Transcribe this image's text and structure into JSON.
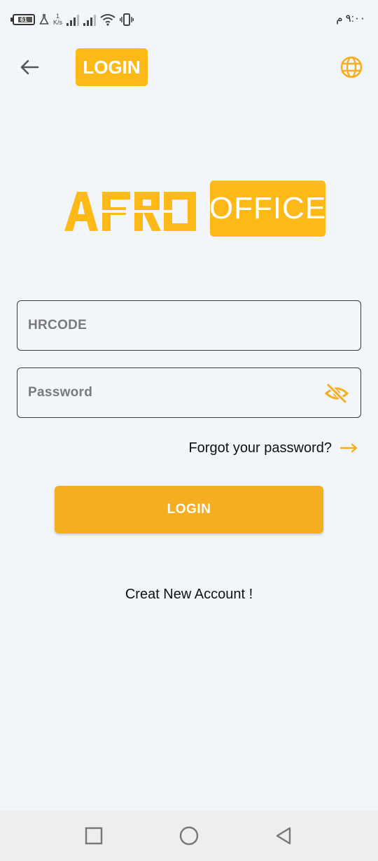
{
  "status_bar": {
    "battery_level": "61",
    "speed_value": "1",
    "speed_unit": "K/s",
    "time": "٩:٠٠ م"
  },
  "app_bar": {
    "back_icon": "arrow-back-icon",
    "title": "LOGIN",
    "language_icon": "globe-icon"
  },
  "logo": {
    "left_text": "AFRO",
    "right_text": "OFFICE"
  },
  "form": {
    "hrcode_placeholder": "HRCODE",
    "password_placeholder": "Password",
    "visibility_icon": "eye-off-icon",
    "forgot_password": "Forgot your password?",
    "forgot_icon": "arrow-right-icon",
    "login_button": "LOGIN",
    "create_account": "Creat New Account !"
  },
  "nav_bar": {
    "items": [
      "recent-apps-icon",
      "home-icon",
      "back-icon"
    ]
  },
  "colors": {
    "accent": "#fdb918",
    "button": "#f5ae1f",
    "background": "#f2f5fa"
  }
}
